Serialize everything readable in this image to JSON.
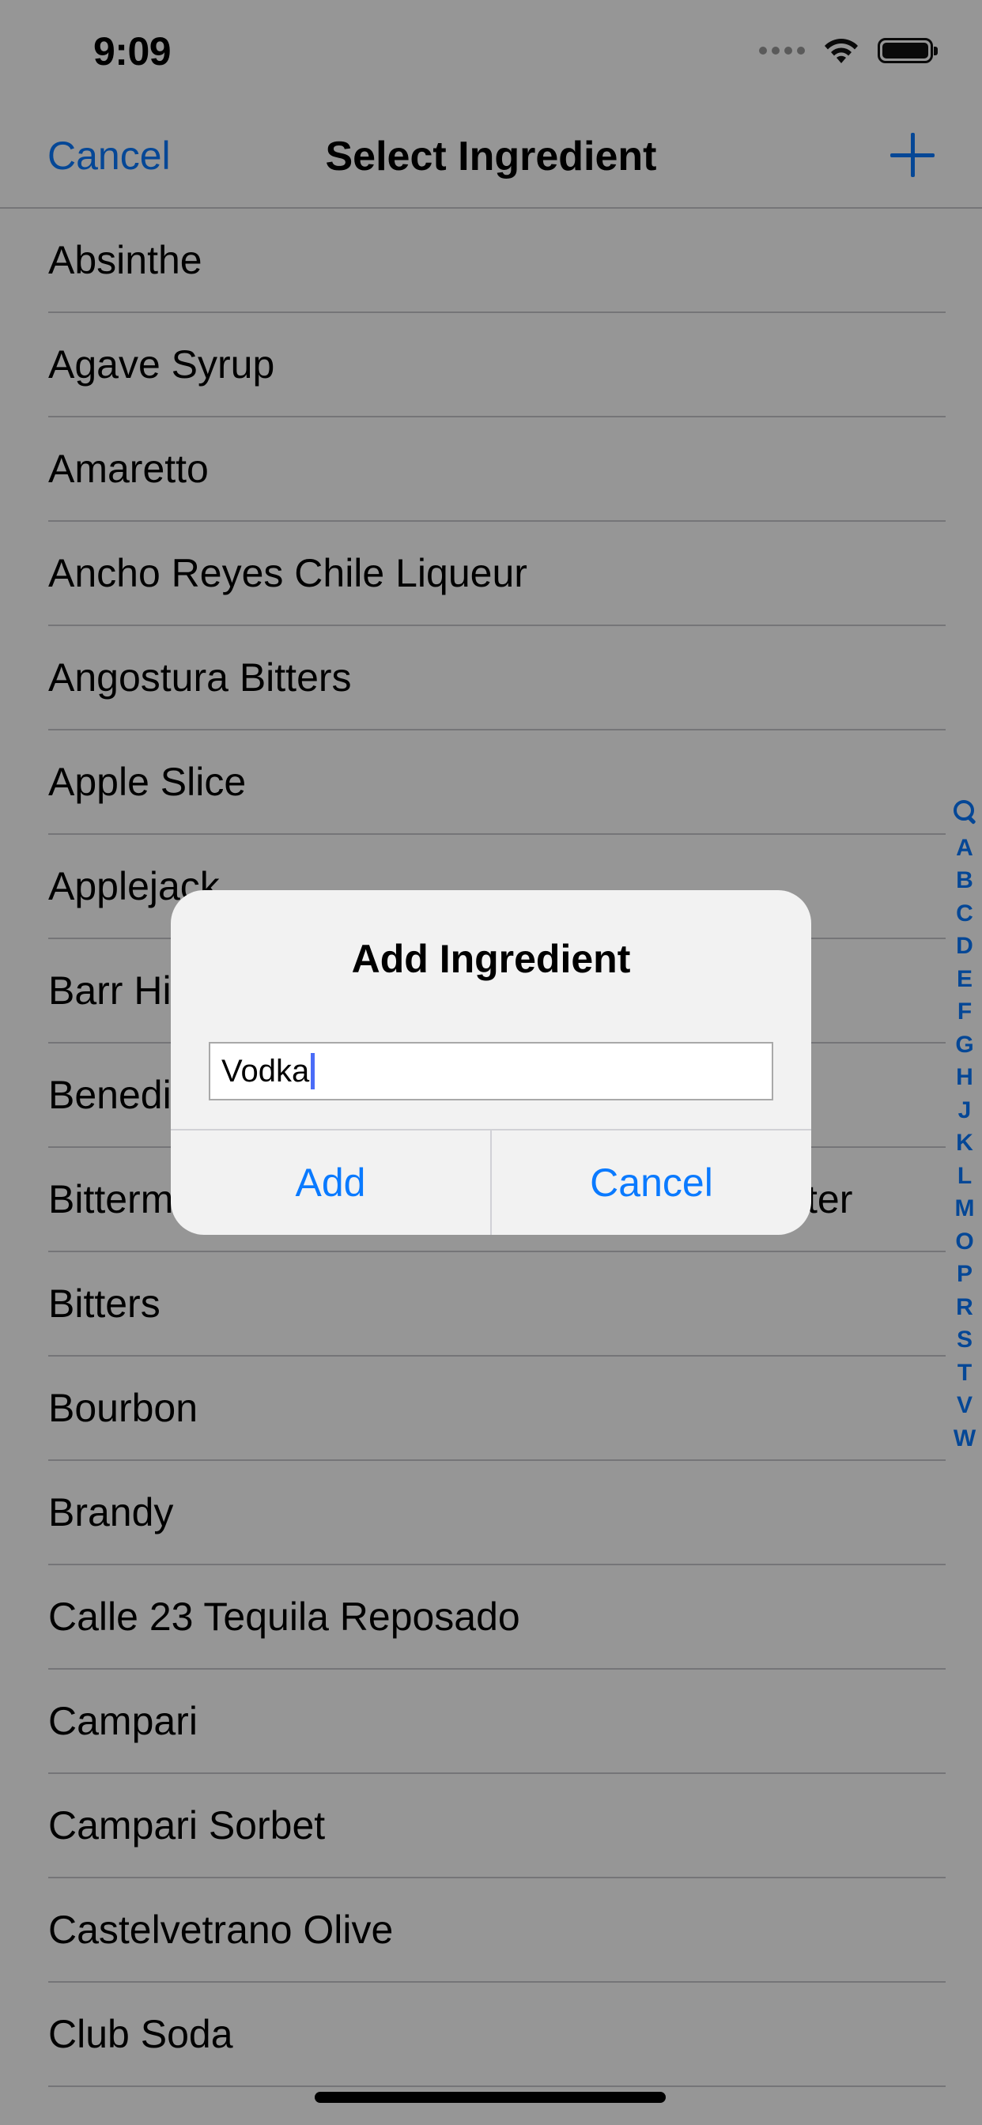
{
  "status_bar": {
    "time": "9:09",
    "icons": [
      "signal-icon",
      "wifi-icon",
      "battery-icon"
    ]
  },
  "nav": {
    "cancel_label": "Cancel",
    "title": "Select Ingredient",
    "add_icon": "plus-icon"
  },
  "ingredients": [
    "Absinthe",
    "Agave Syrup",
    "Amaretto",
    "Ancho Reyes Chile Liqueur",
    "Angostura Bitters",
    "Apple Slice",
    "Applejack",
    "Barr Hi",
    "Benedi",
    "Bitterm",
    "Bitters",
    "Bourbon",
    "Brandy",
    "Calle 23 Tequila Reposado",
    "Campari",
    "Campari Sorbet",
    "Castelvetrano Olive",
    "Club Soda"
  ],
  "partial_text": {
    "bitterm_tail": "ter"
  },
  "section_index": [
    "A",
    "B",
    "C",
    "D",
    "E",
    "F",
    "G",
    "H",
    "J",
    "K",
    "L",
    "M",
    "O",
    "P",
    "R",
    "S",
    "T",
    "V",
    "W"
  ],
  "alert": {
    "title": "Add Ingredient",
    "input_value": "Vodka",
    "add_label": "Add",
    "cancel_label": "Cancel"
  },
  "colors": {
    "accent": "#0a7aff",
    "separator": "#c8c7cc",
    "dim": "rgba(0,0,0,0.41)",
    "alert_bg": "#f2f2f2",
    "caret": "#4a6cf7"
  }
}
